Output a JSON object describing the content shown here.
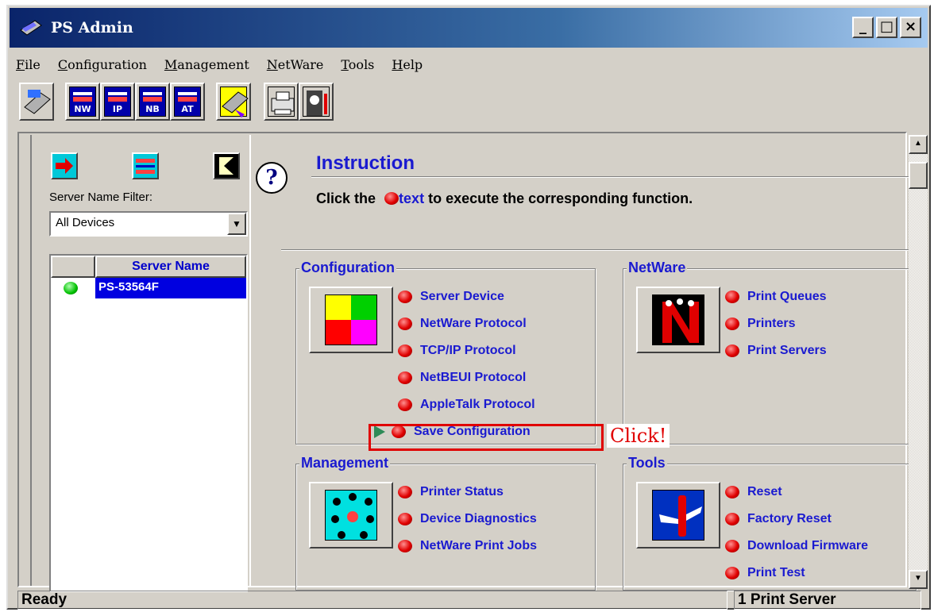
{
  "window": {
    "title": "PS Admin",
    "min": "_",
    "max": "□",
    "close": "×"
  },
  "menu": [
    "File",
    "Configuration",
    "Management",
    "NetWare",
    "Tools",
    "Help"
  ],
  "toolbar": [
    "NW",
    "IP",
    "NB",
    "AT"
  ],
  "left": {
    "filter_label": "Server Name Filter:",
    "filter_value": "All Devices",
    "column_header": "Server Name",
    "servers": [
      "PS-53564F"
    ]
  },
  "help_icon": "?",
  "instruction": {
    "title": "Instruction",
    "text_before": "Click the",
    "text_link": "text",
    "text_after": "to execute the corresponding function."
  },
  "groups": {
    "configuration": {
      "title": "Configuration",
      "items": [
        "Server Device",
        "NetWare Protocol",
        "TCP/IP Protocol",
        "NetBEUI Protocol",
        "AppleTalk Protocol",
        "Save Configuration"
      ]
    },
    "netware": {
      "title": "NetWare",
      "items": [
        "Print Queues",
        "Printers",
        "Print Servers"
      ]
    },
    "management": {
      "title": "Management",
      "items": [
        "Printer Status",
        "Device Diagnostics",
        "NetWare Print Jobs"
      ]
    },
    "tools": {
      "title": "Tools",
      "items": [
        "Reset",
        "Factory Reset",
        "Download Firmware",
        "Print Test"
      ]
    }
  },
  "annotation": "Click!",
  "status": {
    "left": "Ready",
    "right": "1 Print Server"
  },
  "colors": {
    "title_start": "#0a246a",
    "link": "#1a1ad0",
    "selection": "#0000e0",
    "highlight_box": "#e00000"
  }
}
